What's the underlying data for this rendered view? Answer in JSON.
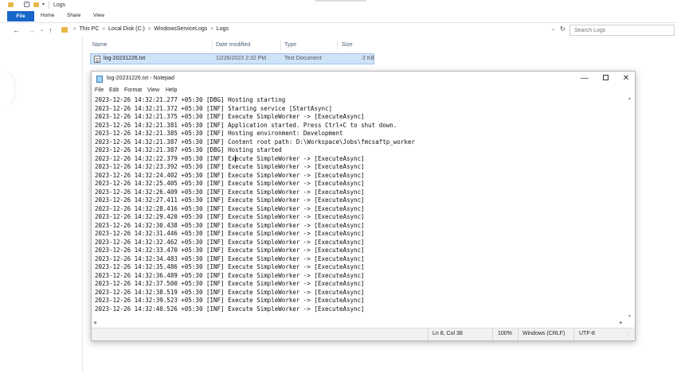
{
  "explorer": {
    "title": "Logs",
    "quick_access": {
      "caret": "▾",
      "check": "✓"
    },
    "ribbon_tabs": [
      "File",
      "Home",
      "Share",
      "View"
    ],
    "nav": {
      "back": "←",
      "forward": "→",
      "dropdown": "⌄",
      "up": "↑",
      "refresh": "↻",
      "addr_dropdown": "⌄"
    },
    "breadcrumbs": [
      "This PC",
      "Local Disk (C:)",
      "WindowsServiceLogs",
      "Logs"
    ],
    "breadcrumb_separator": ">",
    "search_placeholder": "Search Logs",
    "columns": [
      "Name",
      "Date modified",
      "Type",
      "Size"
    ],
    "files": [
      {
        "name": "log-20231226.txt",
        "date_modified": "12/26/2023 2:32 PM",
        "type": "Text Document",
        "size": "2 KB",
        "selected": true
      }
    ],
    "colors": {
      "file_tab": "#1966c9",
      "folder": "#e8b84a",
      "selection": "#cfe3f7"
    }
  },
  "notepad": {
    "title": "log-20231226.txt - Notepad",
    "window_buttons": {
      "minimize": "—",
      "close": "✕"
    },
    "menu": [
      "File",
      "Edit",
      "Format",
      "View",
      "Help"
    ],
    "lines": [
      "2023-12-26 14:32:21.277 +05:30 [DBG] Hosting starting",
      "2023-12-26 14:32:21.372 +05:30 [INF] Starting service [StartAsync]",
      "2023-12-26 14:32:21.375 +05:30 [INF] Execute SimpleWorker -> [ExecuteAsync]",
      "2023-12-26 14:32:21.381 +05:30 [INF] Application started. Press Ctrl+C to shut down.",
      "2023-12-26 14:32:21.385 +05:30 [INF] Hosting environment: Development",
      "2023-12-26 14:32:21.387 +05:30 [INF] Content root path: D:\\Workspace\\Jobs\\fmcsaftp_worker",
      "2023-12-26 14:32:21.387 +05:30 [DBG] Hosting started",
      "2023-12-26 14:32:22.379 +05:30 [INF] Execute SimpleWorker -> [ExecuteAsync]",
      "2023-12-26 14:32:23.392 +05:30 [INF] Execute SimpleWorker -> [ExecuteAsync]",
      "2023-12-26 14:32:24.402 +05:30 [INF] Execute SimpleWorker -> [ExecuteAsync]",
      "2023-12-26 14:32:25.405 +05:30 [INF] Execute SimpleWorker -> [ExecuteAsync]",
      "2023-12-26 14:32:26.409 +05:30 [INF] Execute SimpleWorker -> [ExecuteAsync]",
      "2023-12-26 14:32:27.411 +05:30 [INF] Execute SimpleWorker -> [ExecuteAsync]",
      "2023-12-26 14:32:28.416 +05:30 [INF] Execute SimpleWorker -> [ExecuteAsync]",
      "2023-12-26 14:32:29.420 +05:30 [INF] Execute SimpleWorker -> [ExecuteAsync]",
      "2023-12-26 14:32:30.438 +05:30 [INF] Execute SimpleWorker -> [ExecuteAsync]",
      "2023-12-26 14:32:31.446 +05:30 [INF] Execute SimpleWorker -> [ExecuteAsync]",
      "2023-12-26 14:32:32.462 +05:30 [INF] Execute SimpleWorker -> [ExecuteAsync]",
      "2023-12-26 14:32:33.470 +05:30 [INF] Execute SimpleWorker -> [ExecuteAsync]",
      "2023-12-26 14:32:34.483 +05:30 [INF] Execute SimpleWorker -> [ExecuteAsync]",
      "2023-12-26 14:32:35.486 +05:30 [INF] Execute SimpleWorker -> [ExecuteAsync]",
      "2023-12-26 14:32:36.489 +05:30 [INF] Execute SimpleWorker -> [ExecuteAsync]",
      "2023-12-26 14:32:37.500 +05:30 [INF] Execute SimpleWorker -> [ExecuteAsync]",
      "2023-12-26 14:32:38.519 +05:30 [INF] Execute SimpleWorker -> [ExecuteAsync]",
      "2023-12-26 14:32:39.523 +05:30 [INF] Execute SimpleWorker -> [ExecuteAsync]",
      "2023-12-26 14:32:40.526 +05:30 [INF] Execute SimpleWorker -> [ExecuteAsync]"
    ],
    "status": {
      "position": "Ln 8, Col 38",
      "zoom": "100%",
      "line_ending": "Windows (CRLF)",
      "encoding": "UTF-8"
    }
  }
}
